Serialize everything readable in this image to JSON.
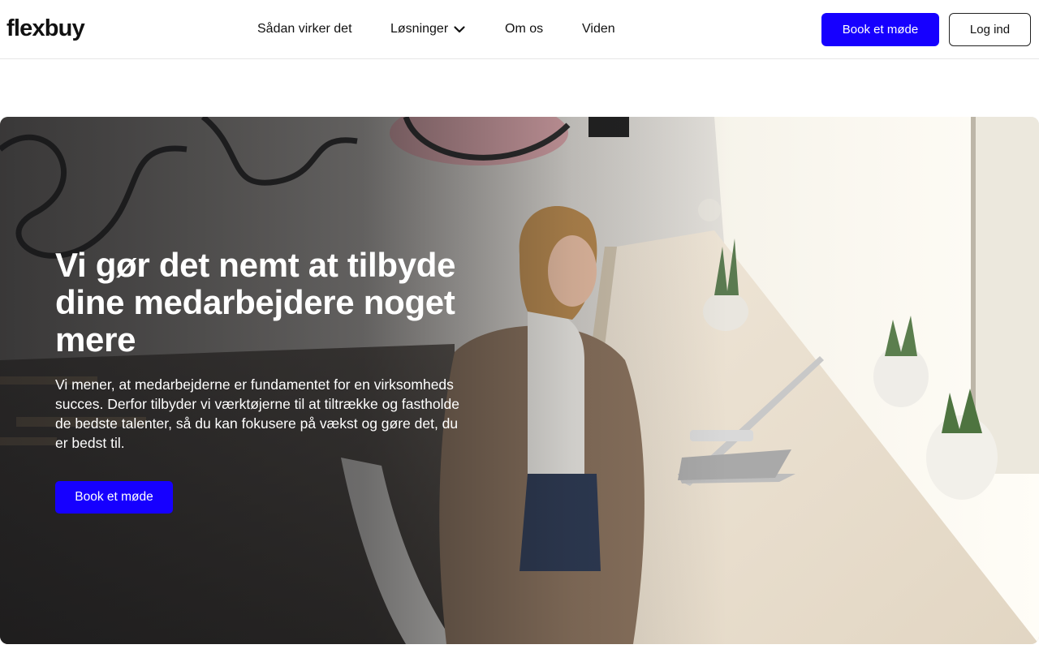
{
  "brand": {
    "logo_text": "flexbuy"
  },
  "nav": {
    "items": [
      {
        "label": "Sådan virker det"
      },
      {
        "label": "Løsninger",
        "icon": "chevron-down-icon"
      },
      {
        "label": "Om os"
      },
      {
        "label": "Viden"
      }
    ]
  },
  "header_actions": {
    "book_label": "Book et møde",
    "login_label": "Log ind"
  },
  "hero": {
    "title": "Vi gør det nemt at tilbyde dine medarbejdere noget mere",
    "text": "Vi mener, at medarbejderne er fundamentet for en virksomheds succes. Derfor tilbyder vi værktøjerne til at tiltrække og fastholde de bedste talenter, så du kan fokusere på vækst og gøre det, du er bedst til.",
    "cta_label": "Book et møde"
  },
  "colors": {
    "accent": "#1600ff",
    "text": "#111111",
    "header_border": "#e6e6e6"
  }
}
